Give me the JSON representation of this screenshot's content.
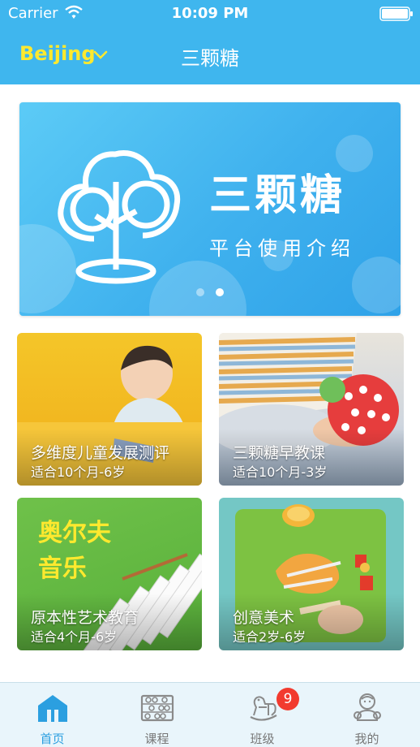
{
  "status_bar": {
    "carrier": "Carrier",
    "time": "10:09 PM"
  },
  "nav": {
    "city": "Beijing",
    "title": "三颗糖"
  },
  "banner": {
    "title": "三颗糖",
    "subtitle": "平台使用介绍",
    "page_count": 2,
    "active_page": 2
  },
  "cards": [
    {
      "title": "多维度儿童发展测评",
      "subtitle": "适合10个月-6岁"
    },
    {
      "title": "三颗糖早教课",
      "subtitle": "适合10个月-3岁"
    },
    {
      "title": "原本性艺术教育",
      "subtitle": "适合4个月-6岁",
      "image_text_line1": "奥尔夫",
      "image_text_line2": "音乐"
    },
    {
      "title": "创意美术",
      "subtitle": "适合2岁-6岁"
    }
  ],
  "tabs": [
    {
      "label": "首页",
      "icon": "home-icon",
      "active": true
    },
    {
      "label": "课程",
      "icon": "abacus-icon",
      "active": false
    },
    {
      "label": "班级",
      "icon": "rocking-horse-icon",
      "active": false,
      "badge": "9"
    },
    {
      "label": "我的",
      "icon": "baby-profile-icon",
      "active": false
    }
  ],
  "colors": {
    "primary": "#3fb6ee",
    "city": "#ffe92e",
    "tab_active": "#2b9fe0",
    "badge": "#f23b2f"
  }
}
